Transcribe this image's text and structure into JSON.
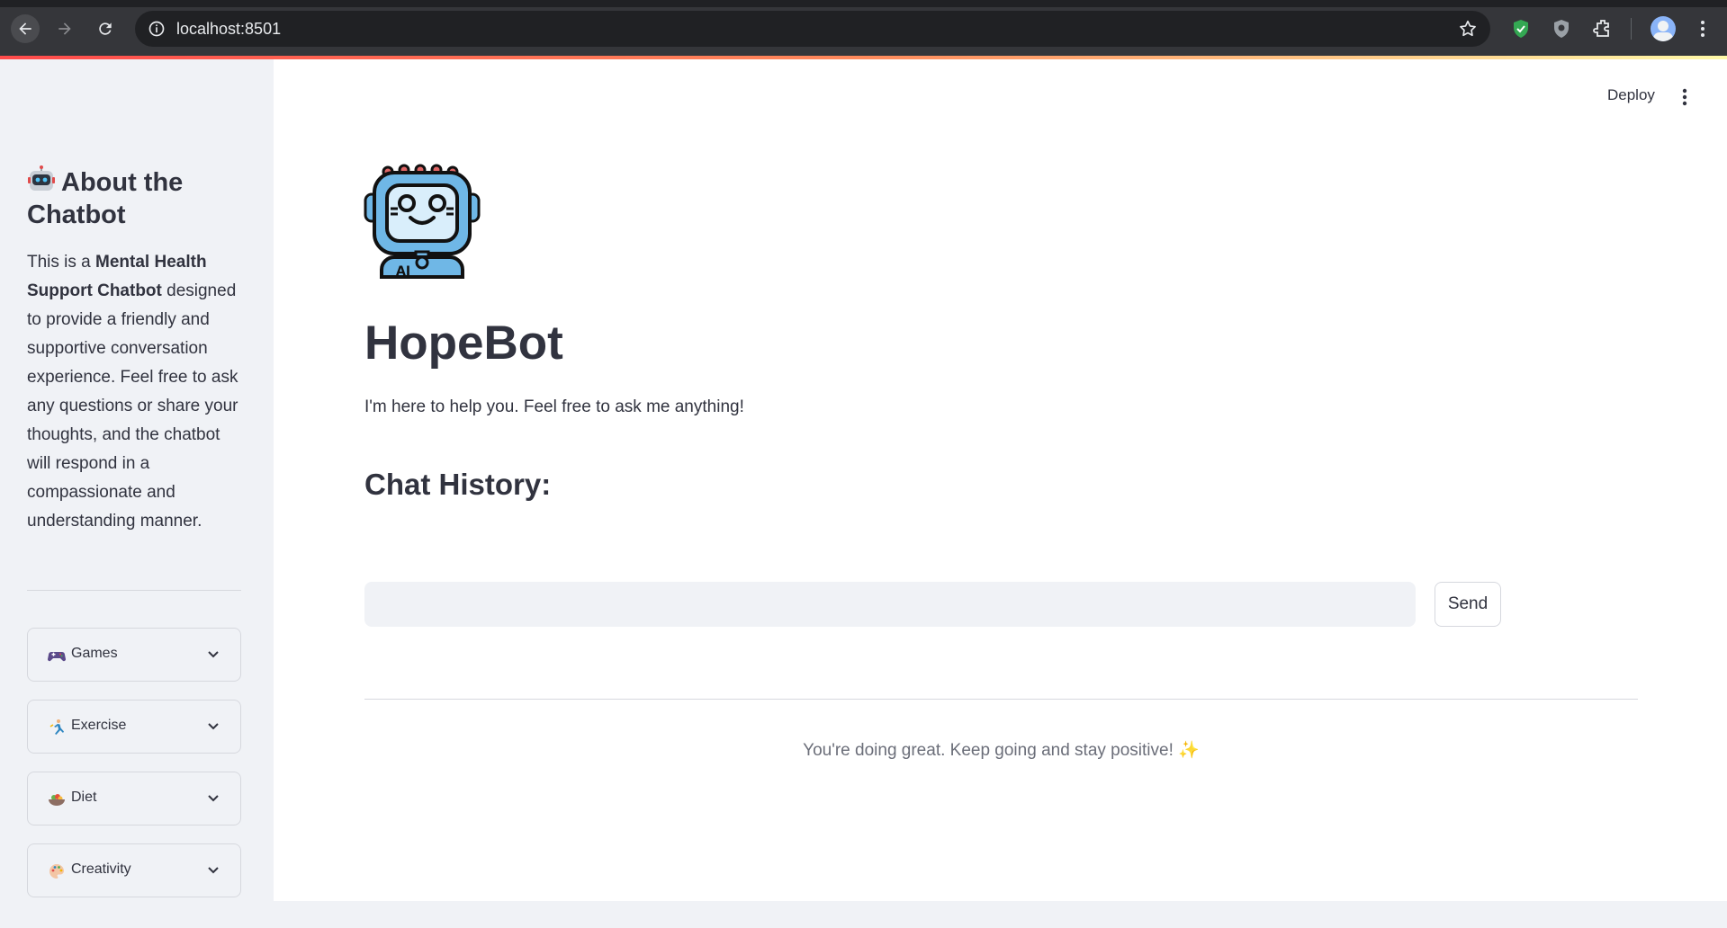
{
  "browser": {
    "url": "localhost:8501"
  },
  "sidebar": {
    "title": "About the Chatbot",
    "description_html_parts": {
      "p1": "This is a ",
      "b1": "Mental Health Support Chatbot",
      "p2": " designed to provide a friendly and supportive conversation experience. Feel free to ask any questions or share your thoughts, and the chatbot will respond in a compassionate and understanding manner."
    },
    "expanders": [
      {
        "label": "Games",
        "icon": "game-controller-icon"
      },
      {
        "label": "Exercise",
        "icon": "running-person-icon"
      },
      {
        "label": "Diet",
        "icon": "salad-bowl-icon"
      },
      {
        "label": "Creativity",
        "icon": "palette-icon"
      }
    ]
  },
  "header": {
    "deploy_label": "Deploy"
  },
  "main": {
    "title": "HopeBot",
    "subtitle": "I'm here to help you. Feel free to ask me anything!",
    "chat_history_heading": "Chat History:",
    "chat_input": {
      "value": "",
      "placeholder": ""
    },
    "send_label": "Send",
    "footer_message": "You're doing great. Keep going and stay positive!",
    "footer_emoji": "✨"
  },
  "colors": {
    "accent_gradient_start": "#ff4b4b",
    "accent_gradient_end": "#fff9a8",
    "sidebar_bg": "#f0f2f6",
    "text": "#31333f"
  }
}
